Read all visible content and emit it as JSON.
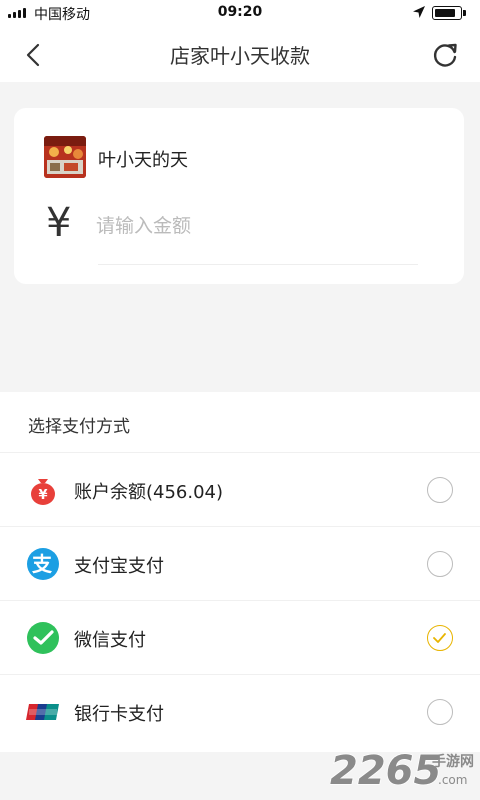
{
  "status_bar": {
    "carrier": "中国移动",
    "time": "09:20",
    "battery_level": 0.85
  },
  "nav": {
    "title": "店家叶小天收款",
    "back_icon": "chevron-left-icon",
    "refresh_icon": "refresh-icon"
  },
  "merchant": {
    "name": "叶小天的天",
    "currency_symbol": "¥",
    "amount_placeholder": "请输入金额",
    "amount_value": ""
  },
  "payment": {
    "header": "选择支付方式",
    "options": [
      {
        "label": "账户余额(456.04)",
        "icon": "money-bag-icon",
        "selected": false
      },
      {
        "label": "支付宝支付",
        "icon": "alipay-icon",
        "selected": false
      },
      {
        "label": "微信支付",
        "icon": "wechat-pay-icon",
        "selected": true
      },
      {
        "label": "银行卡支付",
        "icon": "unionpay-icon",
        "selected": false
      }
    ]
  },
  "watermark": {
    "number": "2265",
    "text": "手游网",
    "domain": ".com"
  },
  "colors": {
    "page_bg": "#f4f4f4",
    "selected_radio": "#e8b400",
    "wallet_red": "#e8403a",
    "alipay_blue": "#1c9fe3",
    "wechat_green": "#2fc15b",
    "unionpay_red": "#d6262e"
  }
}
